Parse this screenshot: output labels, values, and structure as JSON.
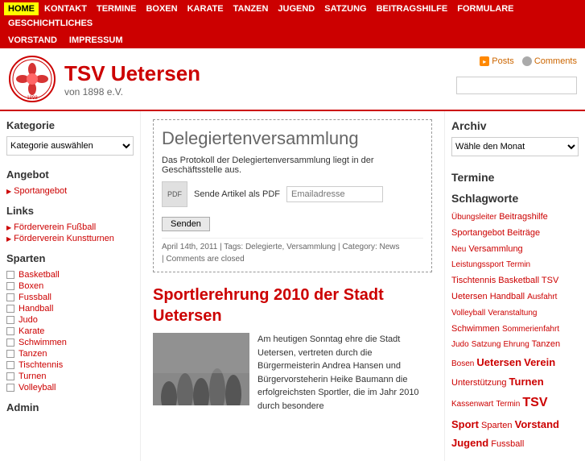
{
  "nav": {
    "items": [
      {
        "label": "HOME",
        "active": true
      },
      {
        "label": "KONTAKT",
        "active": false
      },
      {
        "label": "TERMINE",
        "active": false
      },
      {
        "label": "BOXEN",
        "active": false
      },
      {
        "label": "KARATE",
        "active": false
      },
      {
        "label": "TANZEN",
        "active": false
      },
      {
        "label": "JUGEND",
        "active": false
      },
      {
        "label": "SATZUNG",
        "active": false
      },
      {
        "label": "BEITRAGSHILFE",
        "active": false
      },
      {
        "label": "FORMULARE",
        "active": false
      },
      {
        "label": "GESCHICHTLICHES",
        "active": false
      }
    ],
    "second_row": [
      {
        "label": "VORSTAND"
      },
      {
        "label": "IMPRESSUM"
      }
    ]
  },
  "header": {
    "title": "TSV Uetersen",
    "subtitle": "von 1898 e.V.",
    "feeds": {
      "posts_label": "Posts",
      "comments_label": "Comments"
    },
    "search_placeholder": ""
  },
  "left_sidebar": {
    "kategorie_title": "Kategorie",
    "kategorie_select_placeholder": "Kategorie auswählen",
    "angebot_title": "Angebot",
    "angebot_link": "Sportangebot",
    "links_title": "Links",
    "links": [
      {
        "label": "Förderverein Fußball"
      },
      {
        "label": "Förderverein Kunstturnen"
      }
    ],
    "sparten_title": "Sparten",
    "sparten": [
      "Basketball",
      "Boxen",
      "Fussball",
      "Handball",
      "Judo",
      "Karate",
      "Schwimmen",
      "Tanzen",
      "Tischtennis",
      "Turnen",
      "Volleyball"
    ],
    "admin_title": "Admin"
  },
  "content": {
    "article1": {
      "title": "Delegiertenversammlung",
      "body": "Das Protokoll der Delegiertenversammlung liegt in der Geschäftsstelle aus.",
      "pdf_label": "Sende Artikel als PDF",
      "pdf_placeholder": "Emailadresse",
      "send_button": "Senden",
      "meta": "April 14th, 2011 | Tags: Delegierte, Versammlung | Category: News",
      "comments_closed": "| Comments are closed"
    },
    "article2": {
      "title": "Sportlerehrung 2010 der Stadt Uetersen",
      "body": "Am heutigen Sonntag ehre die Stadt Uetersen, vertreten durch die Bürgermeisterin Andrea Hansen und Bürgervorsteherin Heike Baumann die erfolgreichsten Sportler, die im Jahr 2010 durch besondere"
    }
  },
  "right_sidebar": {
    "archiv_title": "Archiv",
    "archiv_select_placeholder": "Wähle den Monat",
    "termine_title": "Termine",
    "schlagworte_title": "Schlagworte",
    "tags": [
      {
        "label": "Übungsleiter",
        "size": "xsmall"
      },
      {
        "label": "Beitragshilfe",
        "size": "small"
      },
      {
        "label": "Sportangebot",
        "size": "small"
      },
      {
        "label": "Beiträge",
        "size": "small"
      },
      {
        "label": "Neu",
        "size": "xsmall"
      },
      {
        "label": "Versammlung",
        "size": "small"
      },
      {
        "label": "Leistungssport",
        "size": "xsmall"
      },
      {
        "label": "Termin",
        "size": "xsmall"
      },
      {
        "label": "Tischtennis",
        "size": "small"
      },
      {
        "label": "Basketball",
        "size": "small"
      },
      {
        "label": "TSV",
        "size": "small"
      },
      {
        "label": "Uetersen",
        "size": "small"
      },
      {
        "label": "Handball",
        "size": "small"
      },
      {
        "label": "Ausfahrt",
        "size": "xsmall"
      },
      {
        "label": "Volleyball",
        "size": "xsmall"
      },
      {
        "label": "Veranstaltung",
        "size": "xsmall"
      },
      {
        "label": "Schwimmen",
        "size": "small"
      },
      {
        "label": "Sommerienfahrt",
        "size": "xsmall"
      },
      {
        "label": "Judo",
        "size": "xsmall"
      },
      {
        "label": "Satzung",
        "size": "xsmall"
      },
      {
        "label": "Ehrung",
        "size": "xsmall"
      },
      {
        "label": "Tanzen",
        "size": "small"
      },
      {
        "label": "Bosen",
        "size": "xsmall"
      },
      {
        "label": "Uetersen",
        "size": "medium"
      },
      {
        "label": "Verein",
        "size": "medium"
      },
      {
        "label": "Unterstützung",
        "size": "small"
      },
      {
        "label": "Turnen",
        "size": "medium"
      },
      {
        "label": "Kassenwart",
        "size": "xsmall"
      },
      {
        "label": "Termin",
        "size": "xsmall"
      },
      {
        "label": "TSV",
        "size": "large"
      },
      {
        "label": "Sport",
        "size": "medium"
      },
      {
        "label": "Sparten",
        "size": "small"
      },
      {
        "label": "Vorstand",
        "size": "medium"
      },
      {
        "label": "Jugend",
        "size": "medium"
      },
      {
        "label": "Fussball",
        "size": "small"
      }
    ]
  }
}
